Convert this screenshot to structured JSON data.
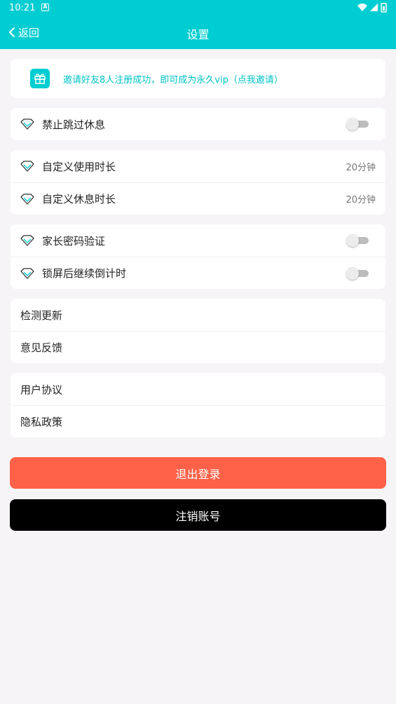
{
  "status": {
    "time": "10:21",
    "notif_icon": "A"
  },
  "header": {
    "back_label": "返回",
    "title": "设置"
  },
  "invite": {
    "text": "邀请好友8人注册成功，即可成为永久vip（点我邀请）"
  },
  "settings": {
    "skip_rest": {
      "label": "禁止跳过休息",
      "enabled": false
    },
    "custom_use": {
      "label": "自定义使用时长",
      "value": "20分钟"
    },
    "custom_rest": {
      "label": "自定义休息时长",
      "value": "20分钟"
    },
    "parent_password": {
      "label": "家长密码验证",
      "enabled": false
    },
    "lock_countdown": {
      "label": "锁屏后继续倒计时",
      "enabled": false
    },
    "check_update": {
      "label": "检测更新"
    },
    "feedback": {
      "label": "意见反馈"
    },
    "user_agreement": {
      "label": "用户协议"
    },
    "privacy_policy": {
      "label": "隐私政策"
    }
  },
  "buttons": {
    "logout": "退出登录",
    "cancel_account": "注销账号"
  },
  "colors": {
    "accent": "#00cdd1",
    "logout": "#ff6148",
    "cancel": "#000000",
    "background": "#f6f4f7"
  }
}
